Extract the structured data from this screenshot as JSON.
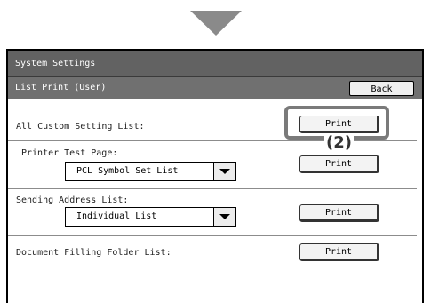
{
  "header": {
    "title": "System Settings",
    "subtitle": "List Print (User)",
    "back_label": "Back"
  },
  "rows": [
    {
      "label": "All Custom Setting List:",
      "button": "Print"
    },
    {
      "label": "Printer Test Page:",
      "select_value": "PCL Symbol Set List",
      "button": "Print"
    },
    {
      "label": "Sending Address List:",
      "select_value": "Individual List",
      "button": "Print"
    },
    {
      "label": "Document Filling Folder List:",
      "button": "Print"
    }
  ],
  "annotation": {
    "callout_label": "(2)"
  },
  "colors": {
    "title_bar": "#626262",
    "sub_bar": "#707070",
    "arrow": "#8a8a8a",
    "highlight": "#7a7a7a"
  }
}
